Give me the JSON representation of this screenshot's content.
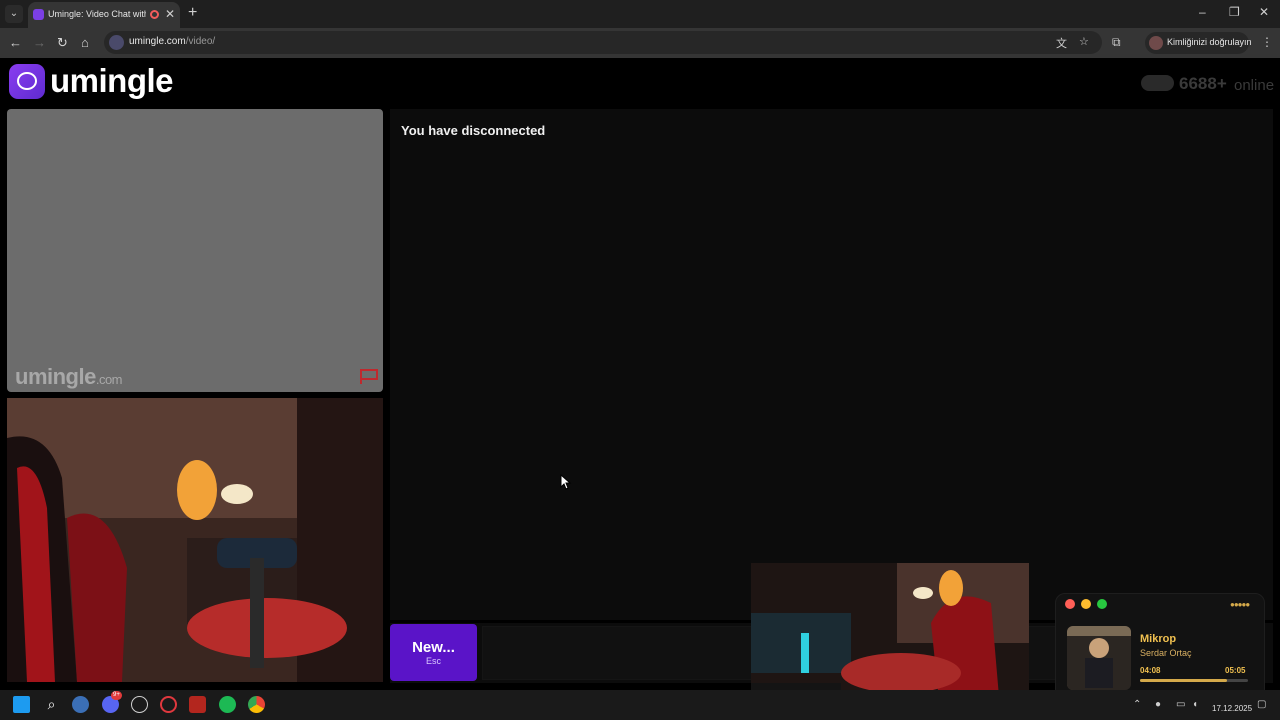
{
  "browser": {
    "tab_title": "Umingle: Video Chat with S",
    "url_host": "umingle.com",
    "url_path": "/video/",
    "profile_label": "Kimliğinizi doğrulayın"
  },
  "page": {
    "logo_text": "umingle",
    "online_count": "6688+",
    "online_word": "online",
    "watermark_main": "umingle",
    "watermark_suffix": ".com",
    "chat_status": "You have disconnected",
    "new_button_label": "New...",
    "new_button_shortcut": "Esc"
  },
  "music_player": {
    "song_title": "Mikrop",
    "artist": "Serdar Ortaç",
    "current_time": "04:08",
    "total_time": "05:05",
    "progress": 0.81,
    "accent_color": "#d4a94a"
  },
  "taskbar": {
    "date": "17.12.2025",
    "discord_badge": "9+"
  },
  "colors": {
    "brand": "#7b3fe4",
    "new_button": "#5a14c8",
    "page_bg": "#000000",
    "panel_bg": "#0c0c0c",
    "stranger_video_bg": "#6c6c6c"
  }
}
